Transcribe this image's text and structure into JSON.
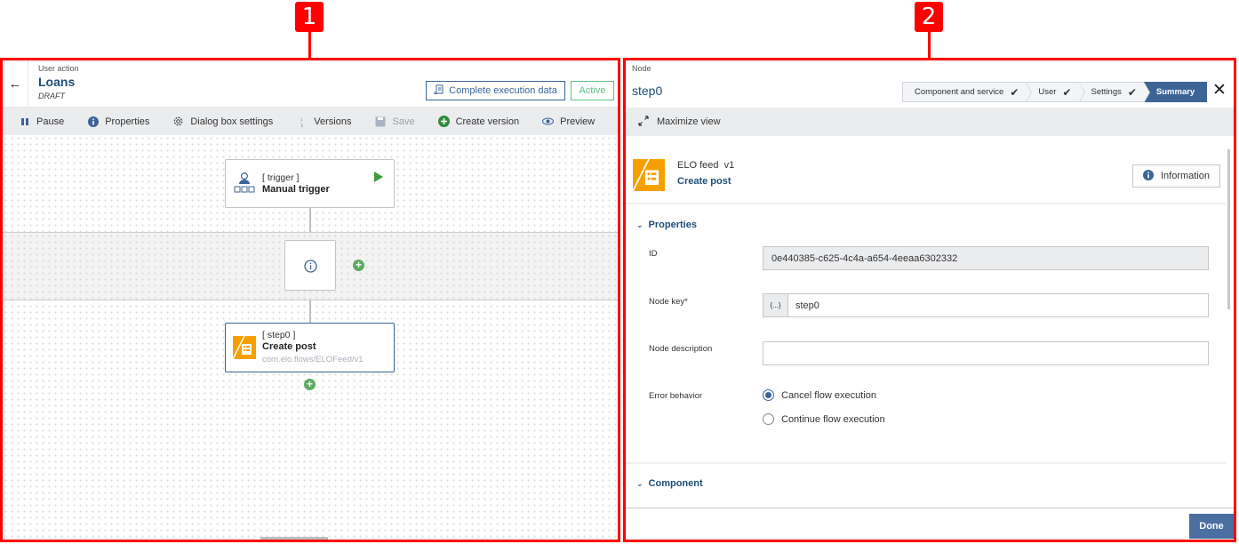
{
  "annotations": [
    "1",
    "2"
  ],
  "left_panel": {
    "eyebrow": "User action",
    "title": "Loans",
    "status_sub": "DRAFT",
    "complete_execution_label": "Complete execution data",
    "active_badge": "Active",
    "toolbar": [
      {
        "icon": "pause-icon",
        "label": "Pause",
        "disabled": false
      },
      {
        "icon": "info-icon",
        "label": "Properties",
        "disabled": false
      },
      {
        "icon": "gear-icon",
        "label": "Dialog box settings",
        "disabled": false
      },
      {
        "icon": "versions-icon",
        "label": "Versions",
        "disabled": false
      },
      {
        "icon": "save-icon",
        "label": "Save",
        "disabled": true
      },
      {
        "icon": "plus-circle-icon",
        "label": "Create version",
        "disabled": false
      },
      {
        "icon": "eye-icon",
        "label": "Preview",
        "disabled": false
      }
    ],
    "nodes": {
      "trigger": {
        "key": "[ trigger ]",
        "name": "Manual trigger"
      },
      "step": {
        "key": "[ step0 ]",
        "name": "Create post",
        "path": "com.elo.flows/ELOFeed/v1"
      }
    }
  },
  "right_panel": {
    "eyebrow": "Node",
    "title": "step0",
    "steps": [
      {
        "label": "Component and service",
        "done": true
      },
      {
        "label": "User",
        "done": true
      },
      {
        "label": "Settings",
        "done": true
      },
      {
        "label": "Summary",
        "current": true
      }
    ],
    "maximize_label": "Maximize view",
    "component": {
      "service": "ELO feed",
      "version": "v1",
      "name": "Create post"
    },
    "information_label": "Information",
    "properties_section": "Properties",
    "fields": {
      "id_label": "ID",
      "id_value": "0e440385-c625-4c4a-a654-4eeaa6302332",
      "node_key_label": "Node key*",
      "node_key_prefix": "{...}",
      "node_key_value": "step0",
      "node_description_label": "Node description",
      "node_description_value": "",
      "error_behavior_label": "Error behavior",
      "error_options": [
        {
          "label": "Cancel flow execution",
          "checked": true
        },
        {
          "label": "Continue flow execution",
          "checked": false
        }
      ]
    },
    "component_section": "Component",
    "done_label": "Done"
  }
}
